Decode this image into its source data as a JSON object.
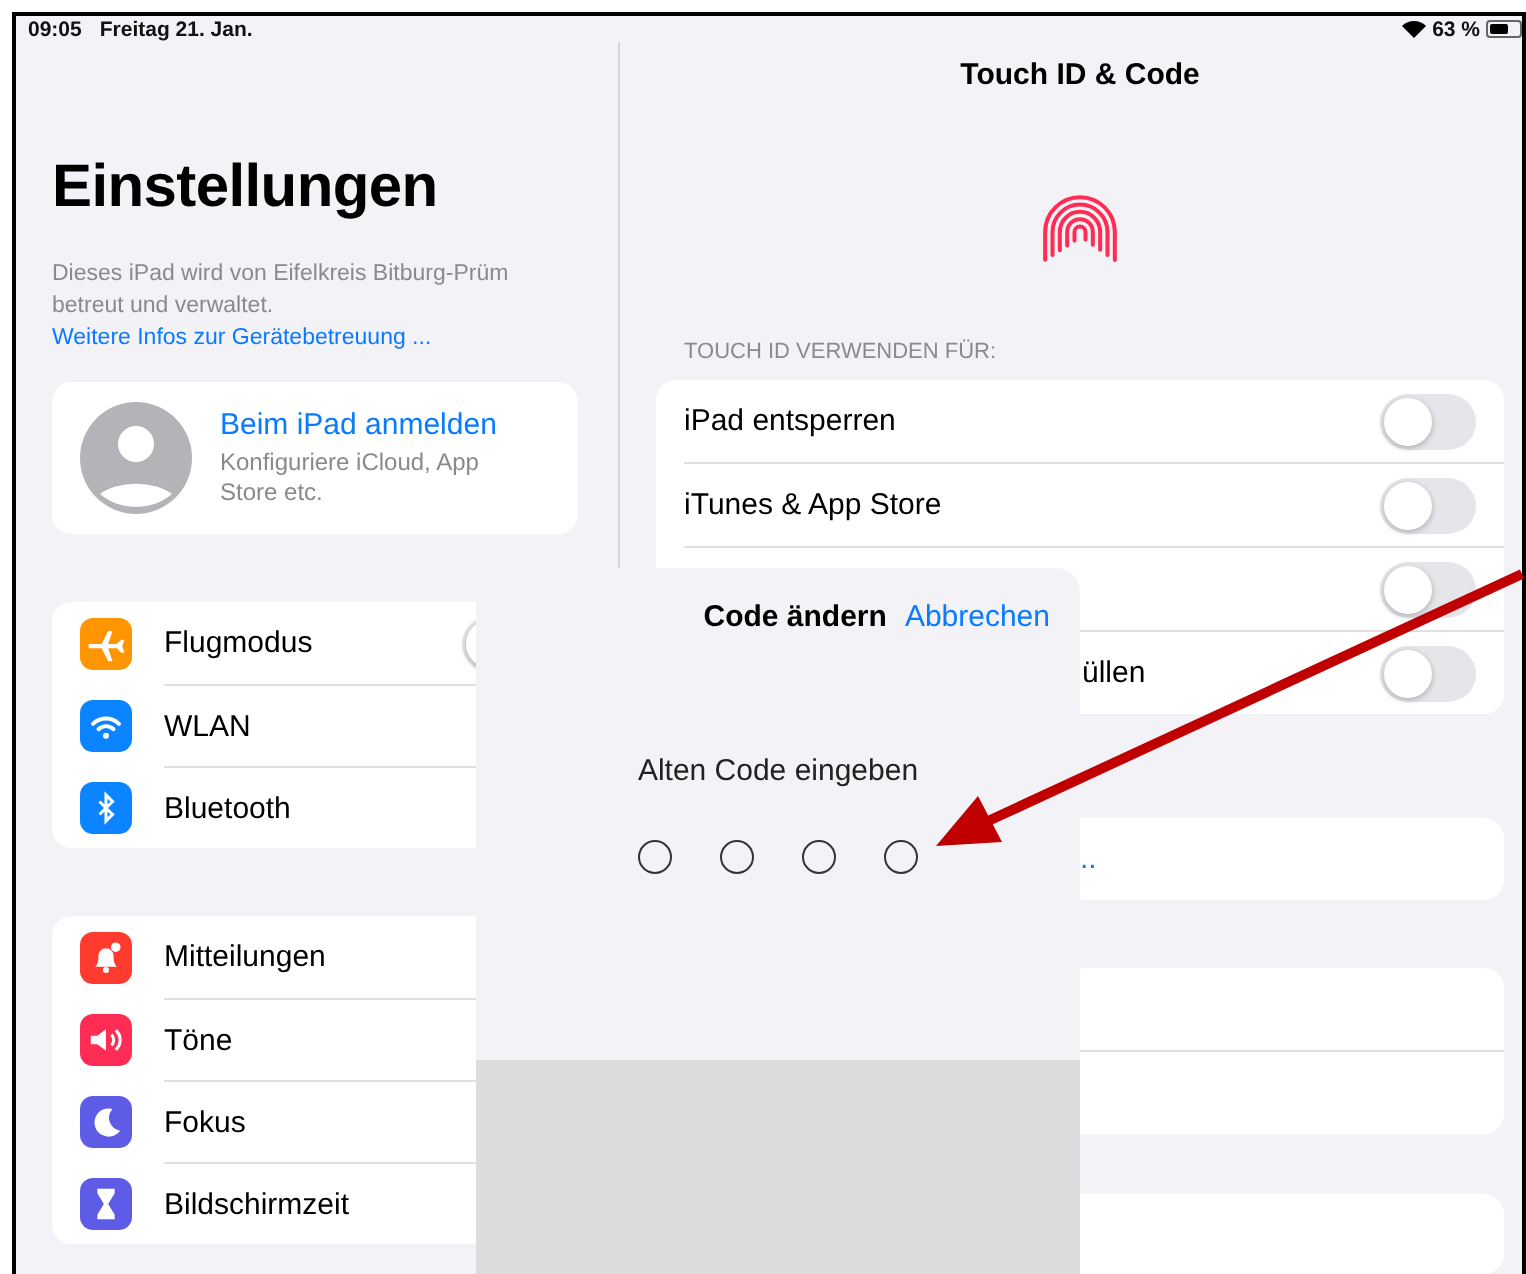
{
  "status_bar": {
    "time": "09:05",
    "date": "Freitag 21. Jan.",
    "battery": "63 %"
  },
  "sidebar": {
    "title": "Einstellungen",
    "notice": "Dieses iPad wird von Eifelkreis Bitburg-Prüm betreut und verwaltet.",
    "notice_link": "Weitere Infos zur Gerätebetreuung ...",
    "account": {
      "title": "Beim iPad anmelden",
      "subtitle": "Konfiguriere iCloud, App Store etc."
    },
    "groups": [
      [
        {
          "label": "Flugmodus",
          "color": "#ff9500",
          "kind": "toggle",
          "on": false
        },
        {
          "label": "WLAN",
          "color": "#0a84ff",
          "kind": "link"
        },
        {
          "label": "Bluetooth",
          "color": "#0a84ff",
          "kind": "link"
        }
      ],
      [
        {
          "label": "Mitteilungen",
          "color": "#ff3b30",
          "kind": "link"
        },
        {
          "label": "Töne",
          "color": "#ff2d55",
          "kind": "link"
        },
        {
          "label": "Fokus",
          "color": "#5e5ce6",
          "kind": "link"
        },
        {
          "label": "Bildschirmzeit",
          "color": "#5e5ce6",
          "kind": "link"
        }
      ]
    ]
  },
  "detail": {
    "title": "Touch ID & Code",
    "section_header": "TOUCH ID VERWENDEN FÜR:",
    "toggles": [
      {
        "label": "iPad entsperren",
        "on": false
      },
      {
        "label": "iTunes & App Store",
        "on": false
      },
      {
        "on": false
      },
      {
        "label": "üllen",
        "on": false
      }
    ],
    "link_row": ".."
  },
  "code_sheet": {
    "title": "Code ändern",
    "cancel": "Abbrechen",
    "prompt": "Alten Code eingeben",
    "digits": [
      {
        "filled": false
      },
      {
        "filled": false
      },
      {
        "filled": false
      },
      {
        "filled": false
      }
    ]
  }
}
